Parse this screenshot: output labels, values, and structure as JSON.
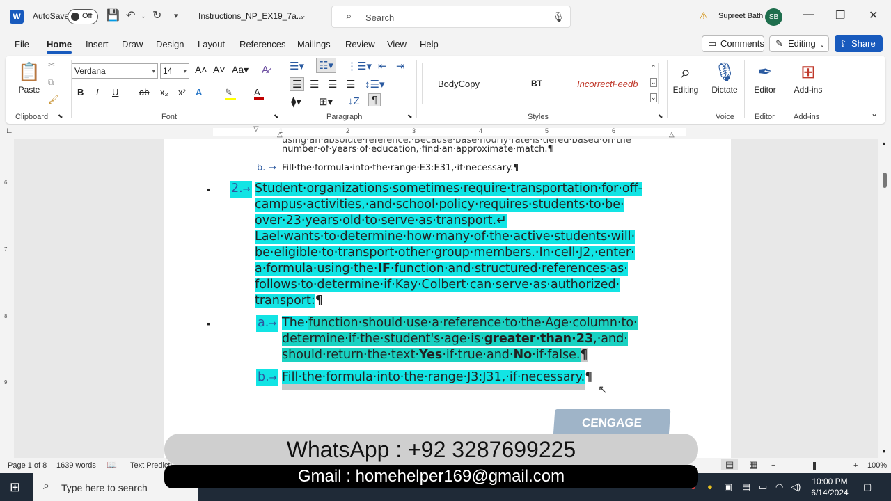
{
  "titlebar": {
    "autosave_label": "AutoSave",
    "autosave_state": "Off",
    "doc_title": "Instructions_NP_EX19_7a...",
    "search_placeholder": "Search",
    "user_name": "Supreet Bath",
    "user_initials": "SB"
  },
  "tabs": [
    "File",
    "Home",
    "Insert",
    "Draw",
    "Design",
    "Layout",
    "References",
    "Mailings",
    "Review",
    "View",
    "Help"
  ],
  "active_tab": "Home",
  "actions": {
    "comments": "Comments",
    "editing": "Editing",
    "share": "Share"
  },
  "ribbon": {
    "paste": "Paste",
    "clipboard": "Clipboard",
    "font_name": "Verdana",
    "font_size": "14",
    "font_group": "Font",
    "paragraph_group": "Paragraph",
    "styles_group": "Styles",
    "styles": [
      "BodyCopy",
      "BT",
      "IncorrectFeedb"
    ],
    "editing": "Editing",
    "dictate": "Dictate",
    "voice": "Voice",
    "editor": "Editor",
    "editor_group": "Editor",
    "addins": "Add-ins",
    "addins_group": "Add-ins"
  },
  "ruler_numbers": [
    "1",
    "2",
    "3",
    "4",
    "5",
    "6"
  ],
  "vruler_numbers": [
    "6",
    "7",
    "8",
    "9"
  ],
  "document": {
    "prev_line": "number·of·years·of·education,·find·an·approximate·match.¶",
    "prev_b_marker": "b.",
    "prev_b_text": "Fill·the·formula·into·the·range·E3:E31,·if·necessary.¶",
    "item2_marker": "2.",
    "item2_lines": [
      "Student·organizations·sometimes·require·transportation·for·off-",
      "campus·activities,·and·school·policy·requires·students·to·be·",
      "over·23·years·old·to·serve·as·transport.↵",
      "Lael·wants·to·determine·how·many·of·the·active·students·will·",
      "be·eligible·to·transport·other·group·members.·In·cell·J2,·enter·",
      "a·formula·using·the·",
      "IF",
      "·function·and·structured·references·as·",
      "follows·to·determine·if·Kay·Colbert·can·serve·as·authorized·",
      "transport:",
      "¶"
    ],
    "sub_a_marker": "a.",
    "sub_a": {
      "l1_pre": "The·",
      "l1_main": "function·should·use·a·reference·to·the·Age·column·to·",
      "l2_pre": "determine·if·the·student's·age·is·",
      "l2_bold": "greater·than·23",
      "l2_post": ",·and·",
      "l3_pre": "should·return·the·text·",
      "l3_b1": "Yes",
      "l3_mid": "·if·true·and·",
      "l3_b2": "No",
      "l3_post": "·if·false.",
      "pilcrow": "¶"
    },
    "sub_b_marker": "b.",
    "sub_b_text": "Fill·the·formula·into·the·range·J3:J31,·if·necessary.",
    "sub_b_pilcrow": "¶",
    "logo_text": "CENGAGE"
  },
  "overlay": {
    "whatsapp": "WhatsApp :  +92 3287699225",
    "gmail": "Gmail : homehelper169@gmail.com"
  },
  "statusbar": {
    "page": "Page 1 of 8",
    "words": "1639 words",
    "text_pred": "Text Predicti",
    "zoom": "100%"
  },
  "taskbar": {
    "search_placeholder": "Type here to search",
    "time": "10:00 PM",
    "date": "6/14/2024"
  },
  "colors": {
    "accent": "#185abd",
    "highlight_cyan": "#12e4e4",
    "highlight_teal": "#1ad2c2"
  }
}
